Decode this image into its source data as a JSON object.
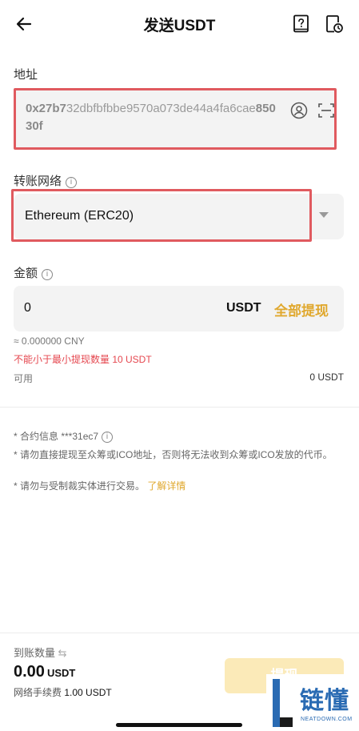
{
  "header": {
    "title": "发送USDT",
    "back_icon": "back-arrow-icon",
    "help_icon": "help-book-icon",
    "history_icon": "history-record-icon"
  },
  "address": {
    "label": "地址",
    "value_bold_start": "0x27b7",
    "value_middle": "32dbfbfbbe9570a073de44a4fa6cae",
    "value_bold_end": "85030f",
    "contact_icon": "contact-book-icon",
    "scan_icon": "scan-qr-icon"
  },
  "network": {
    "label": "转账网络",
    "selected": "Ethereum (ERC20)"
  },
  "amount": {
    "label": "金额",
    "value": "0",
    "unit": "USDT",
    "max_label": "全部提现",
    "cny_estimate": "≈ 0.000000 CNY",
    "min_warning": "不能小于最小提现数量 10 USDT",
    "available_label": "可用",
    "available_value": "0 USDT"
  },
  "notes": {
    "contract": "* 合约信息 ***31ec7",
    "ico_warning": "* 请勿直接提现至众筹或ICO地址，否则将无法收到众筹或ICO发放的代币。",
    "sanction_warning": "* 请勿与受制裁实体进行交易。",
    "details_link": "了解详情"
  },
  "footer": {
    "received_label": "到账数量",
    "received_amount": "0.00",
    "received_unit": "USDT",
    "fee_label": "网络手续费",
    "fee_value": "1.00 USDT",
    "submit_label": "提现"
  },
  "watermark": {
    "text": "链懂",
    "sub": "NEATDOWN.COM"
  },
  "colors": {
    "accent": "#e0a82e",
    "highlight_border": "#e05a5f",
    "warning": "#e5474f",
    "submit_disabled": "#fbeab8"
  }
}
